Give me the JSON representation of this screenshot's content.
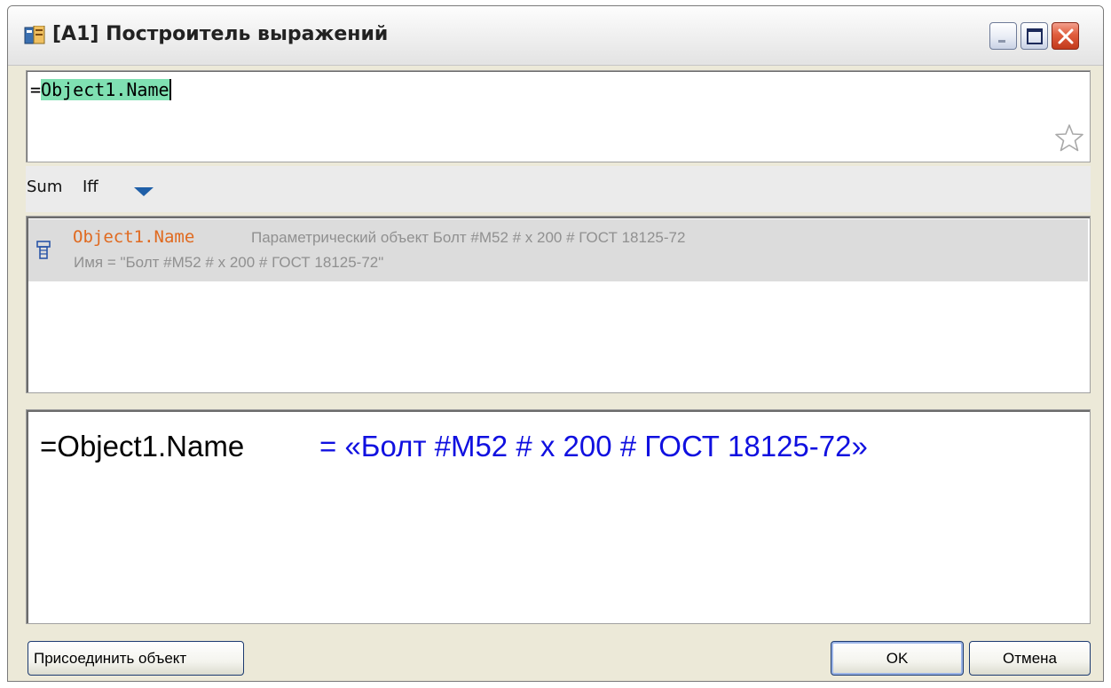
{
  "window": {
    "title": "[A1] Построитель выражений"
  },
  "expression": {
    "prefix": "=",
    "selected_text": "Object1.Name"
  },
  "toolbar": {
    "sum_label": "Sum",
    "iff_label": "Iff"
  },
  "results": [
    {
      "name": "Object1.Name",
      "description": "Параметрический объект Болт #M52 # x 200 # ГОСТ 18125-72",
      "value": "Имя = \"Болт #M52 # x 200 # ГОСТ 18125-72\""
    }
  ],
  "preview": {
    "expression": "=Object1.Name",
    "result": "= «Болт #M52 # x 200 # ГОСТ 18125-72»"
  },
  "buttons": {
    "attach_label": "Присоединить объект",
    "ok_label": "OK",
    "cancel_label": "Отмена"
  },
  "icons": {
    "app": "expression-builder-icon",
    "favorite": "star-icon",
    "dropdown": "triangle-down-icon",
    "object": "bolt-object-icon"
  },
  "colors": {
    "selection": "#7fe0b2",
    "result_name": "#e06a20",
    "preview_result": "#1010e0",
    "muted_text": "#909090"
  }
}
